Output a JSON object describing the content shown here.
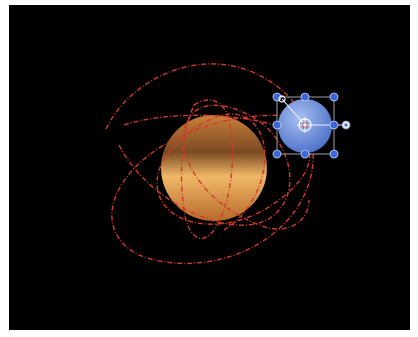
{
  "canvas": {
    "background": "#000000"
  },
  "planet": {
    "name": "planet",
    "color_top": "#c9803a",
    "color_mid_dark": "#7a4a22",
    "color_band": "#f0b868",
    "color_bottom": "#b86a2a"
  },
  "moon": {
    "name": "moon",
    "color_light": "#a8bff0",
    "color_dark": "#4a6fc8"
  },
  "motion_path": {
    "color": "#d03a2a",
    "style": "dashed"
  },
  "transform_box": {
    "frame_color": "#9aa0a8",
    "handle_color": "#3a66d8",
    "rotation_handle_color": "#e8ecf4",
    "anchor_color": "#ffffff"
  },
  "icons": {
    "anchor": "crosshair-anchor-icon",
    "rotate": "rotation-handle-icon",
    "pivot": "pivot-ring-icon"
  }
}
